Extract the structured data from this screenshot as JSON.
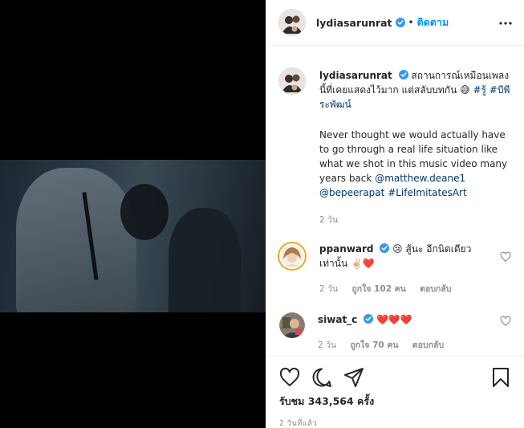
{
  "post": {
    "username": "lydiasarunrat",
    "follow_label": "ติดตาม",
    "caption_thai": "สถานการณ์เหมือนเพลงนี้ที่เคยแสดงไว้มาก แต่สลับบทกัน 😅",
    "caption_tags_thai": "#รู้ #บีพีระพัฒน์",
    "caption_en": "Never thought we would actually have to go through a real life situation like what we shot in this music video many years back",
    "mention_1": "@matthew.deane1",
    "mention_2": "@bepeerapat",
    "hashtag_en": "#LifeImitatesArt",
    "caption_age": "2 วัน"
  },
  "comments": [
    {
      "username": "ppanward",
      "text": "😢 สู้นะ อีกนิดเดียวเท่านั้น ✌🏻❤️",
      "age": "2 วัน",
      "likes": "ถูกใจ 102 คน",
      "reply": "ตอบกลับ"
    },
    {
      "username": "siwat_c",
      "text": "❤️❤️❤️",
      "age": "2 วัน",
      "likes": "ถูกใจ 70 คน",
      "reply": "ตอบกลับ"
    }
  ],
  "footer": {
    "views": "รับชม 343,564 ครั้ง",
    "posted": "2 วันที่แล้ว"
  },
  "icons": {
    "like": "heart-icon",
    "comment": "comment-icon",
    "share": "share-icon",
    "save": "bookmark-icon",
    "more": "more-options-icon",
    "verified": "verified-badge-icon"
  },
  "colors": {
    "verified_blue": "#3897f0",
    "link_blue": "#0095f6",
    "tag_blue": "#00376b",
    "muted": "#8e8e8e",
    "heart_red": "#ed4956"
  }
}
